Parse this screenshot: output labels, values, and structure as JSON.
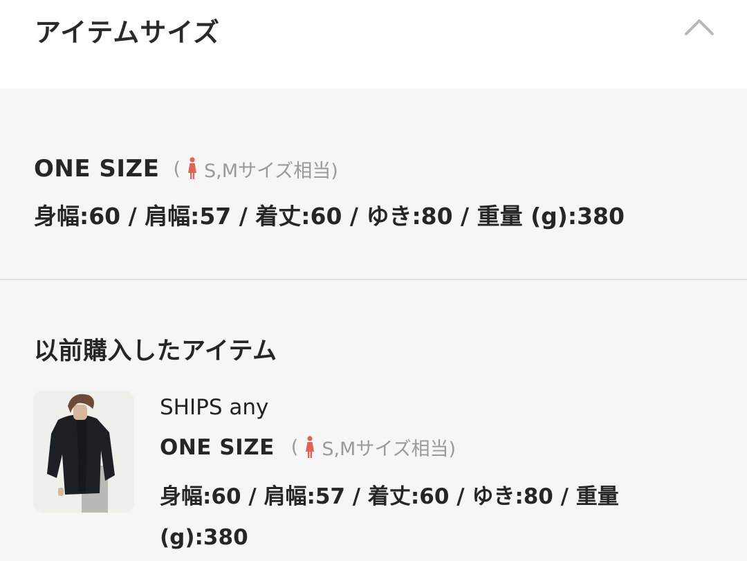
{
  "header": {
    "title": "アイテムサイズ",
    "toggle_icon": "chevron-up-icon"
  },
  "current_size": {
    "name": "ONE SIZE",
    "open_paren": "(",
    "equivalent": "S,Mサイズ相当)",
    "gender_icon": "woman-icon",
    "measurements": "身幅:60 / 肩幅:57 / 着丈:60 / ゆき:80 / 重量 (g):380"
  },
  "purchased": {
    "title": "以前購入したアイテム",
    "item": {
      "brand": "SHIPS any",
      "size_name": "ONE SIZE",
      "open_paren": "(",
      "equivalent": "S,Mサイズ相当)",
      "gender_icon": "woman-icon",
      "measurements": "身幅:60 / 肩幅:57 / 着丈:60 / ゆき:80 / 重量 (g):380"
    }
  },
  "colors": {
    "accent_red": "#e0605a",
    "text": "#262626",
    "muted": "#9a9a9a",
    "panel_bg": "#f6f6f6",
    "header_bg": "#ffffff"
  }
}
